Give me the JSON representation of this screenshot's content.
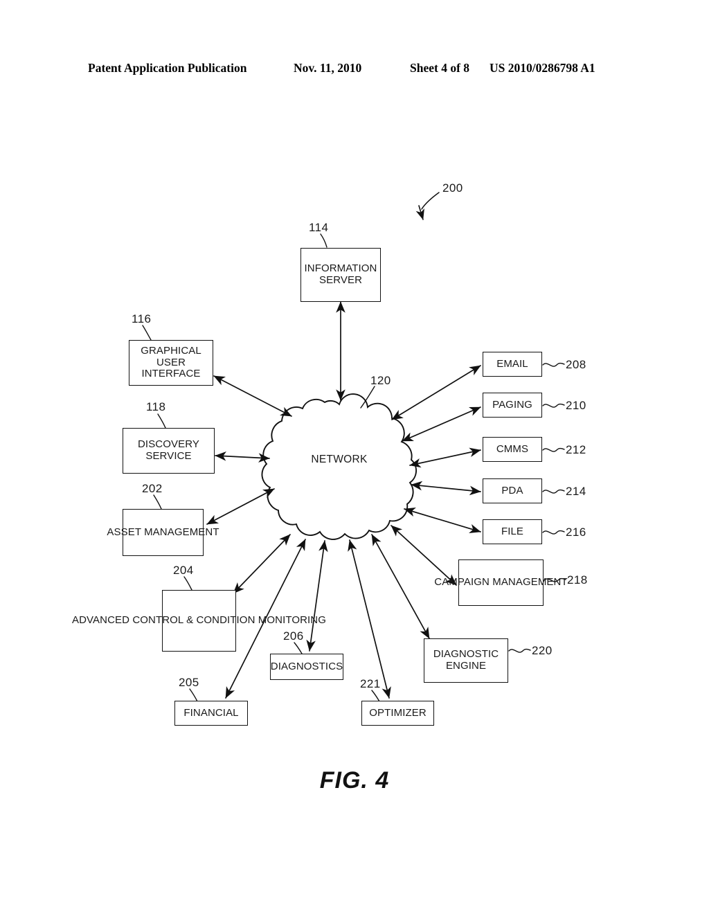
{
  "header": {
    "publication": "Patent Application Publication",
    "date": "Nov. 11, 2010",
    "sheet": "Sheet 4 of 8",
    "patent_number": "US 2010/0286798 A1"
  },
  "figure": {
    "caption": "FIG. 4",
    "system_ref": "200",
    "hub": {
      "label": "NETWORK",
      "ref": "120"
    },
    "nodes": [
      {
        "id": "information-server",
        "label": "INFORMATION\nSERVER",
        "ref": "114"
      },
      {
        "id": "graphical-user-interface",
        "label": "GRAPHICAL\nUSER\nINTERFACE",
        "ref": "116"
      },
      {
        "id": "discovery-service",
        "label": "DISCOVERY\nSERVICE",
        "ref": "118"
      },
      {
        "id": "asset-management",
        "label": "ASSET\nMANAGEMENT",
        "ref": "202"
      },
      {
        "id": "advanced-control-condition-monitoring",
        "label": "ADVANCED\nCONTROL &\nCONDITION\nMONITORING",
        "ref": "204"
      },
      {
        "id": "financial",
        "label": "FINANCIAL",
        "ref": "205"
      },
      {
        "id": "diagnostics",
        "label": "DIAGNOSTICS",
        "ref": "206"
      },
      {
        "id": "email",
        "label": "EMAIL",
        "ref": "208"
      },
      {
        "id": "paging",
        "label": "PAGING",
        "ref": "210"
      },
      {
        "id": "cmms",
        "label": "CMMS",
        "ref": "212"
      },
      {
        "id": "pda",
        "label": "PDA",
        "ref": "214"
      },
      {
        "id": "file",
        "label": "FILE",
        "ref": "216"
      },
      {
        "id": "campaign-management",
        "label": "CAMPAIGN\nMANAGEMENT",
        "ref": "218"
      },
      {
        "id": "diagnostic-engine",
        "label": "DIAGNOSTIC\nENGINE",
        "ref": "220"
      },
      {
        "id": "optimizer",
        "label": "OPTIMIZER",
        "ref": "221"
      }
    ],
    "colors": {
      "ink": "#111111",
      "paper": "#ffffff"
    }
  }
}
